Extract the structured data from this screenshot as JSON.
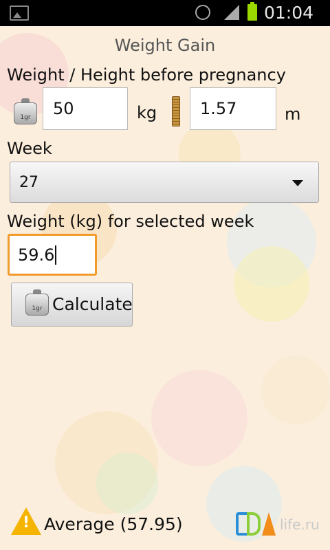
{
  "status_bar": {
    "time": "01:04"
  },
  "title": "Weight Gain",
  "pre_pregnancy": {
    "label": "Weight / Height before pregnancy",
    "weight_value": "50",
    "weight_unit": "kg",
    "height_value": "1.57",
    "height_unit": "m"
  },
  "week": {
    "label": "Week",
    "selected": "27"
  },
  "current_weight": {
    "label": "Weight (kg) for selected week",
    "value": "59.6"
  },
  "calculate_button": {
    "label": "Calculate",
    "icon_text": "1gr"
  },
  "weight_icon_text": "1gr",
  "result": {
    "text": "Average (57.95)",
    "icon": "warning-icon"
  },
  "watermark": {
    "text": "life.ru"
  },
  "colors": {
    "focus_border": "#f29a2a",
    "warning": "#f5b400",
    "background": "#fbeedd"
  }
}
